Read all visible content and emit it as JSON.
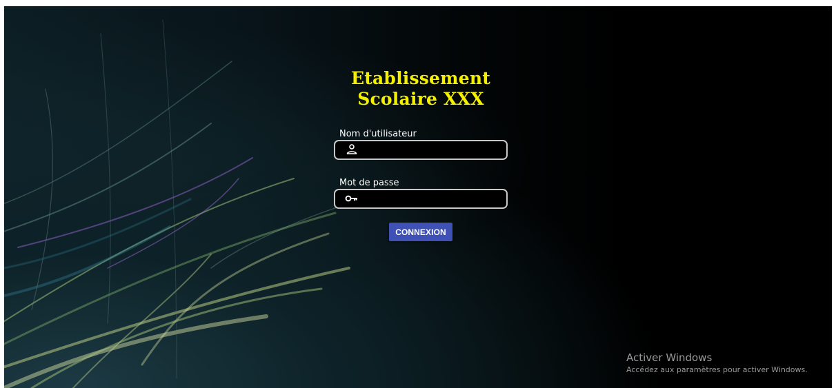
{
  "login": {
    "title_line1": "Etablissement",
    "title_line2": "Scolaire XXX",
    "username": {
      "label": "Nom d'utilisateur",
      "value": "",
      "icon": "user-icon"
    },
    "password": {
      "label": "Mot de passe",
      "value": "",
      "icon": "key-icon"
    },
    "submit_label": "CONNEXION"
  },
  "watermark": {
    "title": "Activer Windows",
    "subtitle": "Accédez aux paramètres pour activer Windows."
  },
  "colors": {
    "title": "#f5f000",
    "button": "#3f51b5",
    "background": "#000000"
  }
}
